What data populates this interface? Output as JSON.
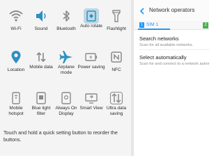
{
  "quick_settings": {
    "rows": [
      [
        {
          "icon": "wifi-icon",
          "label": "Wi-Fi",
          "active": false
        },
        {
          "icon": "sound-icon",
          "label": "Sound",
          "active": true
        },
        {
          "icon": "bluetooth-icon",
          "label": "Bluetooth",
          "active": false
        },
        {
          "icon": "auto-rotate-icon",
          "label": "Auto rotate",
          "active": true
        },
        {
          "icon": "flashlight-icon",
          "label": "Flashlight",
          "active": false
        }
      ],
      [
        {
          "icon": "location-icon",
          "label": "Location",
          "active": true
        },
        {
          "icon": "mobile-data-icon",
          "label": "Mobile data",
          "active": false
        },
        {
          "icon": "airplane-mode-icon",
          "label": "Airplane mode",
          "active": true
        },
        {
          "icon": "power-saving-icon",
          "label": "Power saving",
          "active": false
        },
        {
          "icon": "nfc-icon",
          "label": "NFC",
          "active": false
        }
      ],
      [
        {
          "icon": "mobile-hotspot-icon",
          "label": "Mobile hotspot",
          "active": false
        },
        {
          "icon": "blue-light-filter-icon",
          "label": "Blue light filter",
          "active": false
        },
        {
          "icon": "always-on-display-icon",
          "label": "Always On Display",
          "active": false
        },
        {
          "icon": "smart-view-icon",
          "label": "Smart View",
          "active": false
        },
        {
          "icon": "ultra-data-saving-icon",
          "label": "Ultra data saving",
          "active": false
        }
      ]
    ],
    "hint": "Touch and hold a quick setting button to reorder the buttons."
  },
  "network_operators": {
    "title": "Network operators",
    "sim1_badge": "1",
    "sim1_label": "SIM 1",
    "sim2_badge": "2",
    "options": [
      {
        "title": "Search networks",
        "subtitle": "Scan for all available networks."
      },
      {
        "title": "Select automatically",
        "subtitle": "Scan for and connect to a network automatically."
      }
    ]
  },
  "colors": {
    "active_icon": "#2f8fc1",
    "inactive_icon": "#8a8a8a",
    "accent": "#2196f3",
    "sim2": "#4caf50"
  }
}
